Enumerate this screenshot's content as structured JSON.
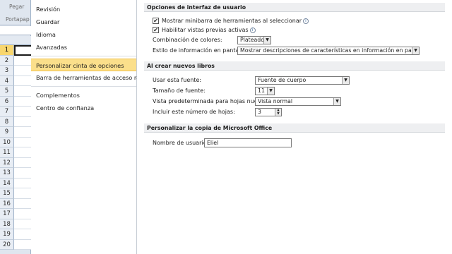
{
  "excel": {
    "ribbon_pegar": "Pegar",
    "ribbon_portapapeles": "Portapap",
    "rows": [
      "1",
      "2",
      "3",
      "4",
      "5",
      "6",
      "7",
      "8",
      "9",
      "10",
      "11",
      "12",
      "13",
      "14",
      "15",
      "16",
      "17",
      "18",
      "19",
      "20"
    ],
    "selected_row": "1"
  },
  "nav": {
    "items": [
      {
        "label": "Revisión"
      },
      {
        "label": "Guardar"
      },
      {
        "label": "Idioma"
      },
      {
        "label": "Avanzadas"
      },
      {
        "label": "Personalizar cinta de opciones"
      },
      {
        "label": "Barra de herramientas de acceso rápido"
      },
      {
        "label": "Complementos"
      },
      {
        "label": "Centro de confianza"
      }
    ],
    "active": "Personalizar cinta de opciones"
  },
  "ui_options": {
    "header": "Opciones de interfaz de usuario",
    "minibar_label": "Mostrar minibarra de herramientas al seleccionar",
    "minibar_checked": true,
    "live_preview_label": "Habilitar vistas previas activas",
    "live_preview_checked": true,
    "color_scheme_label": "Combinación de colores:",
    "color_scheme_value": "Plateado",
    "screentip_label": "Estilo de información en pantalla:",
    "screentip_value": "Mostrar descripciones de características en información en pantalla"
  },
  "new_workbooks": {
    "header": "Al crear nuevos libros",
    "font_label": "Usar esta fuente:",
    "font_value": "Fuente de cuerpo",
    "font_size_label": "Tamaño de fuente:",
    "font_size_value": "11",
    "default_view_label": "Vista predeterminada para hojas nuevas:",
    "default_view_value": "Vista normal",
    "sheets_label": "Incluir este número de hojas:",
    "sheets_value": "3"
  },
  "personalize": {
    "header": "Personalizar la copia de Microsoft Office",
    "username_label": "Nombre de usuario:",
    "username_value": "Eliel"
  },
  "icons": {
    "info": "info-icon",
    "dropdown": "chevron-down-icon",
    "check": "check-icon"
  },
  "colors": {
    "active_nav": "#fbdf8b",
    "section_header": "#eeeff1",
    "excel_frame": "#dfe6ef"
  }
}
